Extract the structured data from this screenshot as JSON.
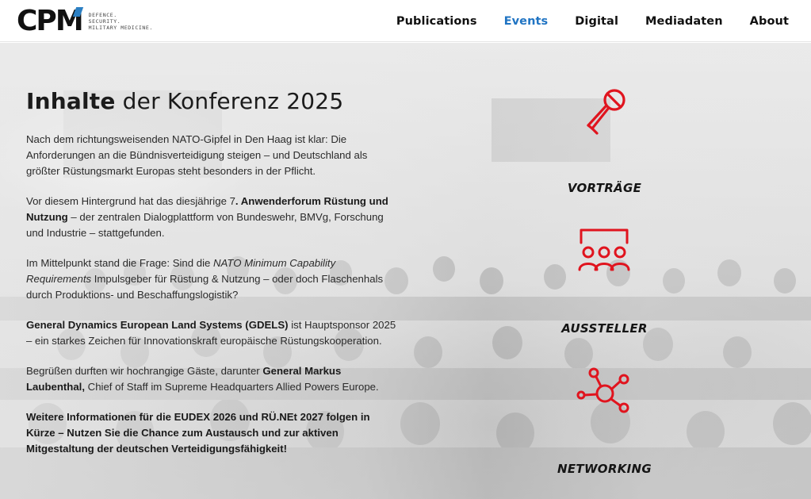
{
  "brand": {
    "logo_text": "CPM",
    "tagline_lines": [
      "DEFENCE.",
      "SECURITY.",
      "MILITARY MEDICINE."
    ]
  },
  "nav": {
    "items": [
      {
        "label": "Publications"
      },
      {
        "label": "Events"
      },
      {
        "label": "Digital"
      },
      {
        "label": "Mediadaten"
      },
      {
        "label": "About"
      }
    ],
    "active": "Events"
  },
  "content": {
    "heading_bold": "Inhalte",
    "heading_rest": " der Konferenz 2025",
    "p1": "Nach dem richtungsweisenden NATO-Gipfel in Den Haag ist klar: Die Anforderungen an die Bündnisverteidigung steigen – und Deutschland als größter Rüstungsmarkt Europas steht besonders in der Pflicht.",
    "p2_a": "Vor diesem Hintergrund hat das diesjährige 7",
    "p2_b": ". Anwenderforum Rüstung und Nutzung",
    "p2_c": " – der zentralen Dialogplattform von Bundeswehr, BMVg, Forschung und Industrie – stattgefunden.",
    "p3_a": "Im Mittelpunkt stand die Frage: Sind die ",
    "p3_b": "NATO Minimum Capability Requirements",
    "p3_c": " Impulsgeber für Rüstung & Nutzung – oder doch Flaschenhals durch Produktions- und Beschaffungslogistik?",
    "p4_a": "General Dynamics European Land Systems (GDELS)",
    "p4_b": " ist Hauptsponsor 2025 – ein starkes Zeichen für Innovationskraft europäische Rüstungskooperation.",
    "p5_a": "Begrüßen durften wir hochrangige Gäste, darunter ",
    "p5_b": "General Markus Laubenthal,",
    "p5_c": " Chief of Staff im Supreme Headquarters Allied Powers Europe.",
    "p6": "Weitere Informationen für die EUDEX 2026 und RÜ.NEt 2027 folgen in Kürze – Nutzen Sie die Chance zum Austausch und zur aktiven Mitgestaltung der deutschen Verteidigungsfähigkeit!"
  },
  "features": [
    {
      "label": "VORTRÄGE",
      "icon": "microphone-icon"
    },
    {
      "label": "AUSSTELLER",
      "icon": "audience-icon"
    },
    {
      "label": "NETWORKING",
      "icon": "network-icon"
    }
  ],
  "colors": {
    "accent_red": "#e0141e",
    "nav_active": "#2074c3",
    "logo_blue": "#2b7fc3"
  }
}
